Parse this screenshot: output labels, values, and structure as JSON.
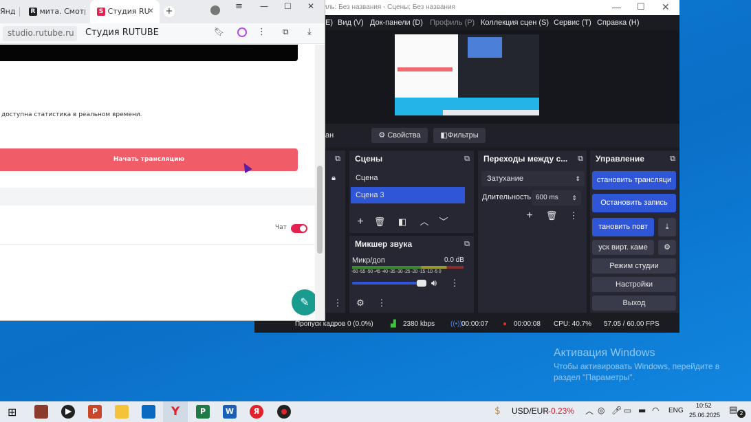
{
  "browser": {
    "tabs": [
      {
        "label": "Янд"
      },
      {
        "label": "мита. Смотр"
      },
      {
        "label": "Студия RU"
      }
    ],
    "address": {
      "domain": "studio.rutube.ru",
      "page_title": "Студия RUTUBE"
    },
    "content": {
      "stats_text": "доступна статистика в реальном времени.",
      "start_stream_label": "Начать трансляцию",
      "chat_label": "Чат"
    }
  },
  "obs": {
    "title": "иль: Без названия - Сцены: Без названия",
    "menu": [
      "E)",
      "Вид (V)",
      "Док-панели (D)",
      "Профиль (P)",
      "Коллекция сцен (S)",
      "Сервис (T)",
      "Справка (H)"
    ],
    "source_bar": {
      "prefix": "ан",
      "properties_label": "Свойства",
      "filters_label": "Фильтры"
    },
    "scenes": {
      "title": "Сцены",
      "items": [
        "Сцена",
        "Сцена 3"
      ]
    },
    "transitions": {
      "title": "Переходы между с...",
      "selected": "Затухание",
      "duration_label": "Длительность",
      "duration_value": "600 ms"
    },
    "controls": {
      "title": "Управление",
      "start_stream": "становить трансляци",
      "stop_record": "Остановить запись",
      "replay": "тановить повт",
      "virtual_cam": "уск вирт. каме",
      "studio_mode": "Режим студии",
      "settings": "Настройки",
      "exit": "Выход"
    },
    "mixer": {
      "title": "Микшер звука",
      "channel": "Микр/доп",
      "level": "0.0 dB",
      "scale": "-60 -55 -50 -45 -40 -35 -30 -25 -20 -15 -10 -5 0",
      "volume": 0.95
    },
    "status": {
      "dropped": "Пропуск кадров 0 (0.0%)",
      "bitrate": "2380 kbps",
      "stream_time": "00:00:07",
      "record_time": "00:00:08",
      "cpu": "CPU: 40.7%",
      "fps": "57.05 / 60.00 FPS"
    }
  },
  "windows_activation": {
    "title": "Активация Windows",
    "line1": "Чтобы активировать Windows, перейдите в",
    "line2": "раздел \"Параметры\"."
  },
  "taskbar": {
    "currency": "USD/EUR",
    "change": "-0.23%",
    "lang": "ENG",
    "time": "10:52",
    "date": "25.06.2025",
    "notif_count": "2"
  }
}
